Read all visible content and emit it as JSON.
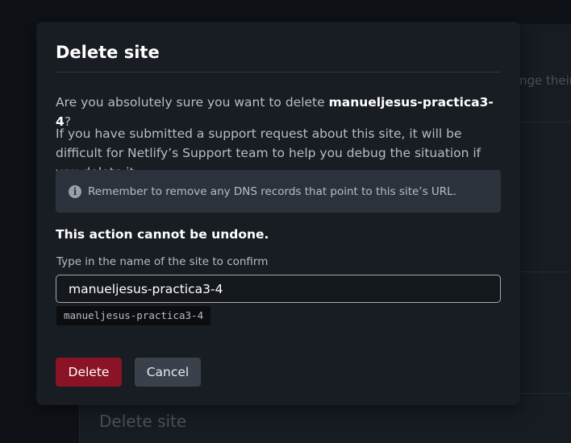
{
  "background": {
    "side_text": "nge their",
    "heading": "Delete site"
  },
  "modal": {
    "title": "Delete site",
    "question_prefix": "Are you absolutely sure you want to delete ",
    "site_name": "manueljesus-practica3-4",
    "question_suffix": "?",
    "support_text": "If you have submitted a support request about this site, it will be difficult for Netlify’s Support team to help you debug the situation if you delete it.",
    "info_icon": "info-icon",
    "info_text": "Remember to remove any DNS records that point to this site’s URL.",
    "warning": "This action cannot be undone.",
    "confirm_label": "Type in the name of the site to confirm",
    "confirm_value": "manueljesus-practica3-4",
    "confirm_hint": "manueljesus-practica3-4",
    "delete_label": "Delete",
    "cancel_label": "Cancel"
  },
  "colors": {
    "danger": "#8a1425",
    "modal_bg": "#181c23",
    "info_bg": "#2c323b"
  }
}
